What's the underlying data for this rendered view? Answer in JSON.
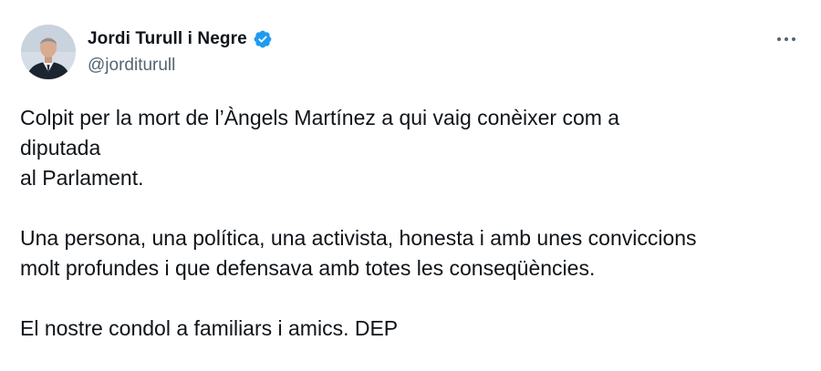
{
  "author": {
    "display_name": "Jordi Turull i Negre",
    "handle": "@jorditurull",
    "verified": true
  },
  "tweet": {
    "paragraphs": [
      [
        "Colpit per la mort de l’Àngels Martínez a qui vaig conèixer com a",
        "diputada",
        "al Parlament."
      ],
      [
        "Una persona, una política, una activista, honesta i amb unes conviccions",
        "molt profundes i que defensava amb totes les conseqüències."
      ],
      [
        "El nostre condol a familiars i amics. DEP"
      ]
    ]
  },
  "icons": {
    "verified": "verified-badge-icon",
    "more": "more-options-icon"
  },
  "colors": {
    "text": "#0f1419",
    "secondary": "#536471",
    "verified_blue": "#1d9bf0"
  }
}
